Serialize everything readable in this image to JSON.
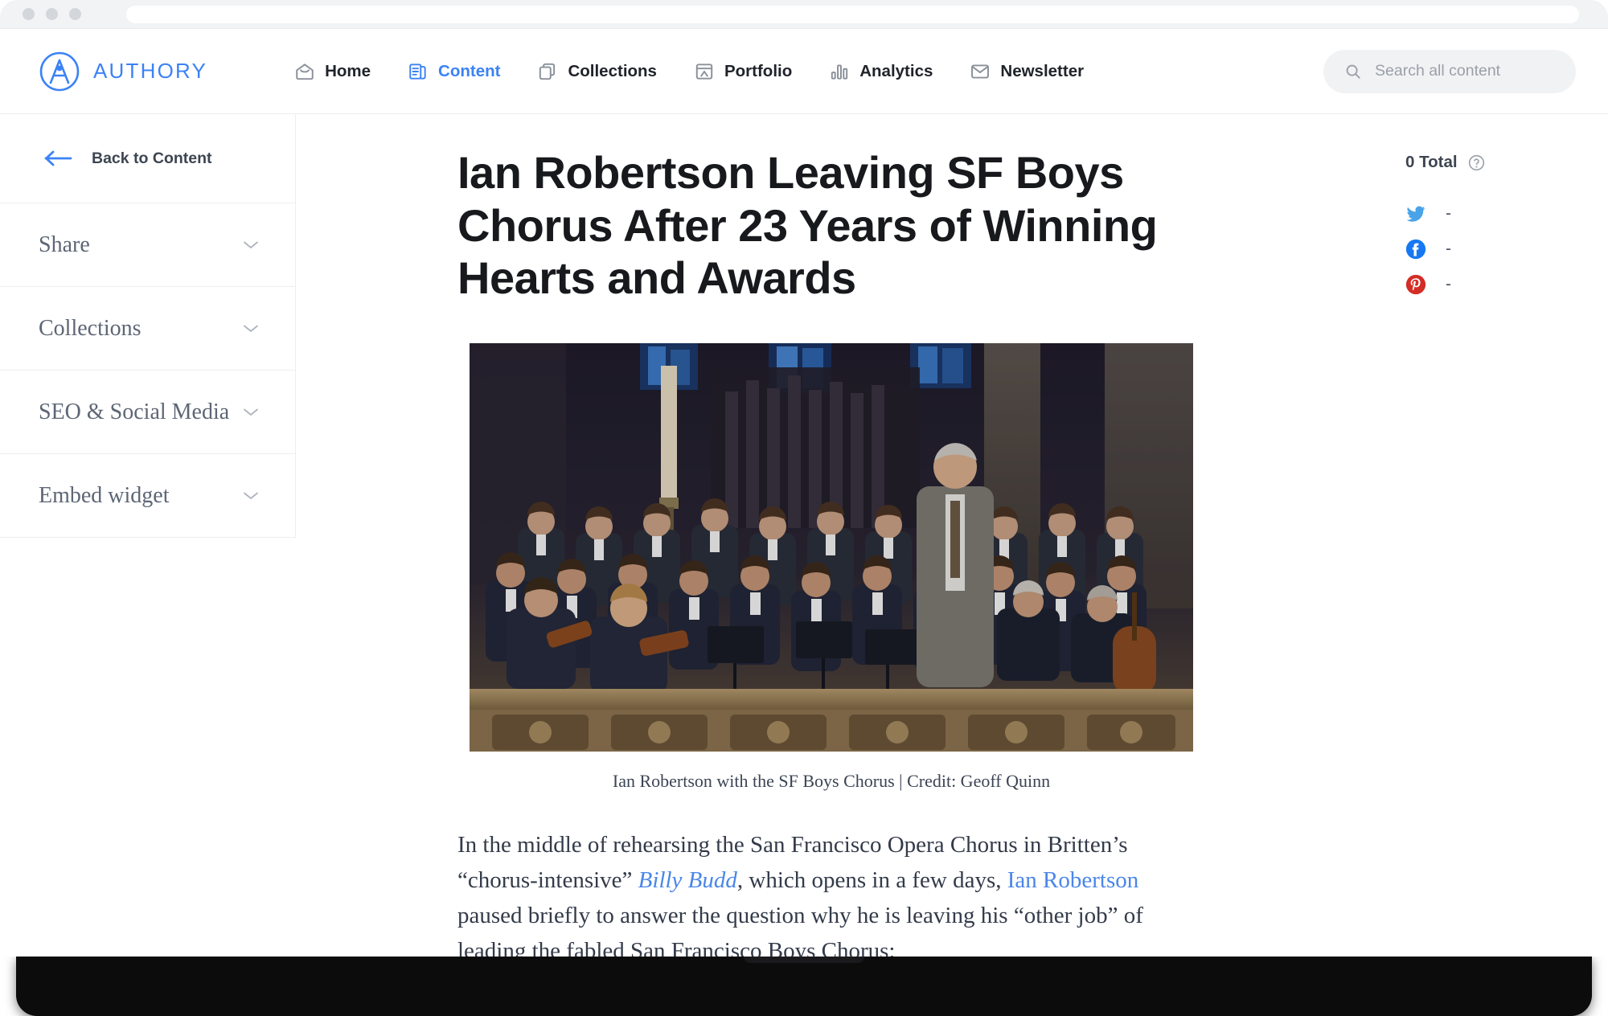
{
  "browser": {
    "url_value": "",
    "traffic_lights": [
      "close",
      "minimize",
      "maximize"
    ]
  },
  "header": {
    "brand_name": "AUTHORY",
    "brand_color": "#3b82f6",
    "nav": [
      {
        "label": "Home",
        "icon": "home-envelope-icon",
        "active": false
      },
      {
        "label": "Content",
        "icon": "content-document-icon",
        "active": true
      },
      {
        "label": "Collections",
        "icon": "collections-copy-icon",
        "active": false
      },
      {
        "label": "Portfolio",
        "icon": "portfolio-layout-icon",
        "active": false
      },
      {
        "label": "Analytics",
        "icon": "analytics-bars-icon",
        "active": false
      },
      {
        "label": "Newsletter",
        "icon": "newsletter-mail-icon",
        "active": false
      }
    ],
    "search": {
      "icon": "search-icon",
      "placeholder": "Search all content",
      "value": ""
    }
  },
  "sidebar": {
    "back": {
      "label": "Back to Content",
      "icon": "arrow-left-icon"
    },
    "sections": [
      {
        "label": "Share",
        "icon": "chevron-down-icon"
      },
      {
        "label": "Collections",
        "icon": "chevron-down-icon"
      },
      {
        "label": "SEO & Social Media",
        "icon": "chevron-down-icon"
      },
      {
        "label": "Embed widget",
        "icon": "chevron-down-icon"
      }
    ]
  },
  "article": {
    "headline": "Ian Robertson Leaving SF Boys Chorus After 23 Years of Winning Hearts and Awards",
    "figure": {
      "caption": "Ian Robertson with the SF Boys Chorus | Credit: Geoff Quinn",
      "alt": "Ian Robertson conducting the San Francisco Boys Chorus with orchestra inside a cathedral"
    },
    "paragraph": {
      "part1": "In the middle of rehearsing the San Francisco Opera Chorus in Britten’s “chorus-intensive” ",
      "link1": "Billy Budd",
      "part2": ", which opens in a few days, ",
      "link2": "Ian Robertson",
      "part3": " paused briefly to answer the question why he is leaving his “other job” of leading the fabled San Francisco Boys Chorus:"
    }
  },
  "rail": {
    "total_label": "0 Total",
    "help_icon": "question-mark-circle-icon",
    "stats": [
      {
        "network": "twitter",
        "icon": "twitter-icon",
        "value": "-",
        "color": "#4aa3e8"
      },
      {
        "network": "facebook",
        "icon": "facebook-icon",
        "value": "-",
        "color": "#1877f2"
      },
      {
        "network": "pinterest",
        "icon": "pinterest-icon",
        "value": "-",
        "color": "#d32d26"
      }
    ]
  }
}
